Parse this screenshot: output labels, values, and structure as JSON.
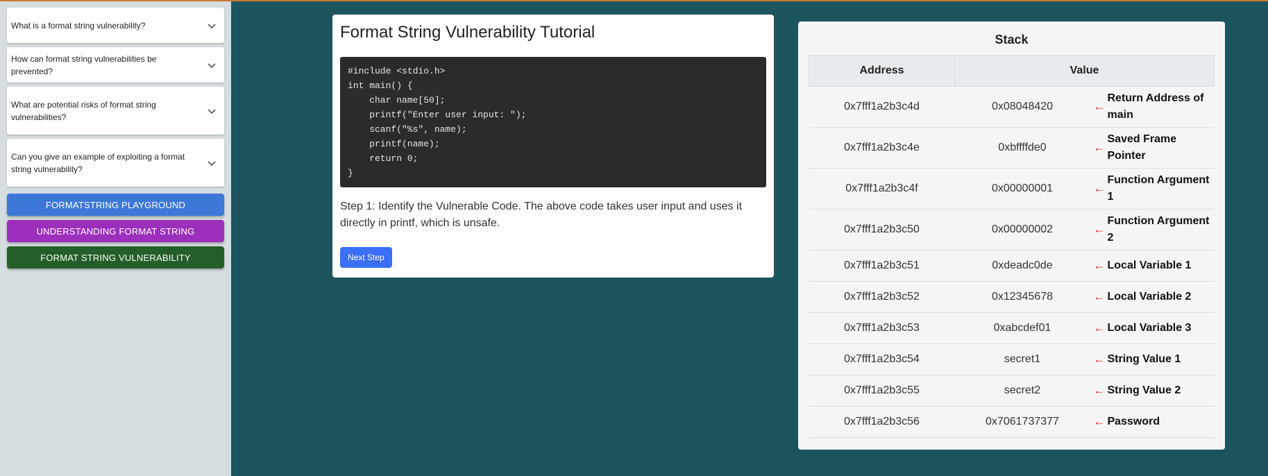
{
  "sidebar": {
    "faq": [
      {
        "question": "What is a format string vulnerability?"
      },
      {
        "question": "How can format string vulnerabilities be prevented?"
      },
      {
        "question": "What are potential risks of format string vulnerabilities?"
      },
      {
        "question": "Can you give an example of exploiting a format string vulnerability?"
      }
    ],
    "buttons": [
      {
        "label": "FORMATSTRING PLAYGROUND",
        "color": "#3d78d8"
      },
      {
        "label": "UNDERSTANDING FORMAT STRING",
        "color": "#9c2fbb"
      },
      {
        "label": "FORMAT STRING VULNERABILITY",
        "color": "#245e28"
      }
    ]
  },
  "tutorial": {
    "title": "Format String Vulnerability Tutorial",
    "code": "#include <stdio.h>\nint main() {\n    char name[50];\n    printf(\"Enter user input: \");\n    scanf(\"%s\", name);\n    printf(name);\n    return 0;\n}",
    "step_text": "Step 1: Identify the Vulnerable Code. The above code takes user input and uses it directly in printf, which is unsafe.",
    "next_label": "Next Step"
  },
  "stack": {
    "title": "Stack",
    "headers": {
      "address": "Address",
      "value": "Value"
    },
    "rows": [
      {
        "address": "0x7fff1a2b3c4d",
        "value": "0x08048420",
        "label": "Return Address of main"
      },
      {
        "address": "0x7fff1a2b3c4e",
        "value": "0xbffffde0",
        "label": "Saved Frame Pointer"
      },
      {
        "address": "0x7fff1a2b3c4f",
        "value": "0x00000001",
        "label": "Function Argument 1"
      },
      {
        "address": "0x7fff1a2b3c50",
        "value": "0x00000002",
        "label": "Function Argument 2"
      },
      {
        "address": "0x7fff1a2b3c51",
        "value": "0xdeadc0de",
        "label": "Local Variable 1"
      },
      {
        "address": "0x7fff1a2b3c52",
        "value": "0x12345678",
        "label": "Local Variable 2"
      },
      {
        "address": "0x7fff1a2b3c53",
        "value": "0xabcdef01",
        "label": "Local Variable 3"
      },
      {
        "address": "0x7fff1a2b3c54",
        "value": "secret1",
        "label": "String Value 1"
      },
      {
        "address": "0x7fff1a2b3c55",
        "value": "secret2",
        "label": "String Value 2"
      },
      {
        "address": "0x7fff1a2b3c56",
        "value": "0x7061737377",
        "label": "Password"
      }
    ],
    "arrow": "←"
  },
  "colors": {
    "background": "#1b545d",
    "sidebar": "#d6dde0",
    "next_button": "#3b6ff5",
    "arrow": "#e02020"
  },
  "icons": {
    "faq_toggle": "chevron-down-icon",
    "stack_pointer": "arrow-left-icon"
  }
}
